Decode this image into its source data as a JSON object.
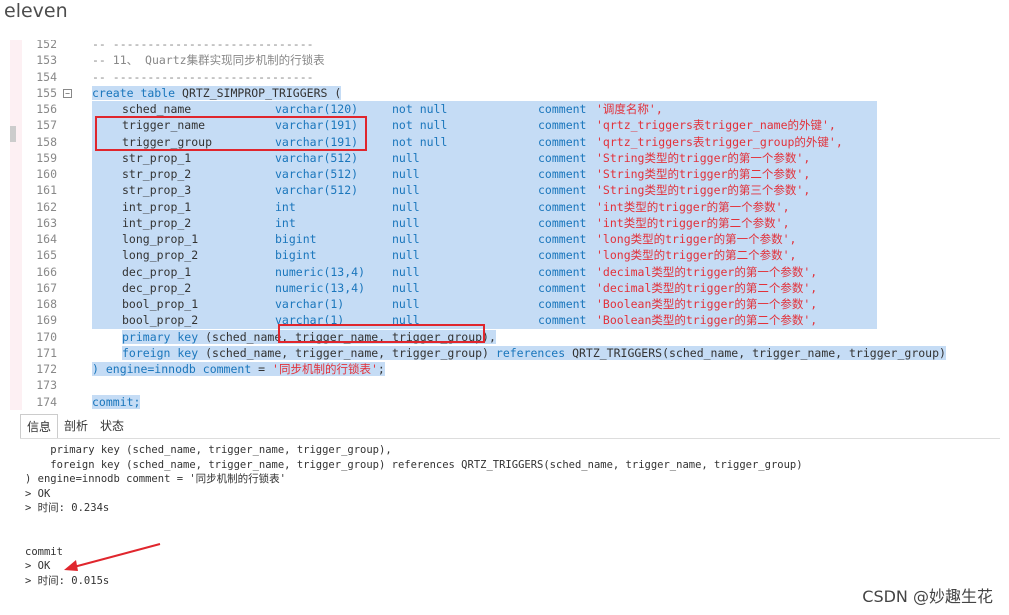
{
  "heading": "eleven",
  "editor": {
    "lines": [
      {
        "n": "152",
        "text": "-- -----------------------------"
      },
      {
        "n": "153",
        "text": "-- 11、 Quartz集群实现同步机制的行锁表"
      },
      {
        "n": "154",
        "text": "-- -----------------------------"
      },
      {
        "n": "155",
        "kw1": "create table",
        "rest": " QRTZ_SIMPROP_TRIGGERS ("
      },
      {
        "n": "156",
        "c1": "sched_name",
        "c2": "varchar(120)",
        "c3": "not null",
        "c4k": "comment",
        "c4s": "'调度名称',"
      },
      {
        "n": "157",
        "c1": "trigger_name",
        "c2": "varchar(191)",
        "c3": "not null",
        "c4k": "comment",
        "c4s": "'qrtz_triggers表trigger_name的外键',"
      },
      {
        "n": "158",
        "c1": "trigger_group",
        "c2": "varchar(191)",
        "c3": "not null",
        "c4k": "comment",
        "c4s": "'qrtz_triggers表trigger_group的外键',"
      },
      {
        "n": "159",
        "c1": "str_prop_1",
        "c2": "varchar(512)",
        "c3": "null",
        "c4k": "comment",
        "c4s": "'String类型的trigger的第一个参数',"
      },
      {
        "n": "160",
        "c1": "str_prop_2",
        "c2": "varchar(512)",
        "c3": "null",
        "c4k": "comment",
        "c4s": "'String类型的trigger的第二个参数',"
      },
      {
        "n": "161",
        "c1": "str_prop_3",
        "c2": "varchar(512)",
        "c3": "null",
        "c4k": "comment",
        "c4s": "'String类型的trigger的第三个参数',"
      },
      {
        "n": "162",
        "c1": "int_prop_1",
        "c2": "int",
        "c3": "null",
        "c4k": "comment",
        "c4s": "'int类型的trigger的第一个参数',"
      },
      {
        "n": "163",
        "c1": "int_prop_2",
        "c2": "int",
        "c3": "null",
        "c4k": "comment",
        "c4s": "'int类型的trigger的第二个参数',"
      },
      {
        "n": "164",
        "c1": "long_prop_1",
        "c2": "bigint",
        "c3": "null",
        "c4k": "comment",
        "c4s": "'long类型的trigger的第一个参数',"
      },
      {
        "n": "165",
        "c1": "long_prop_2",
        "c2": "bigint",
        "c3": "null",
        "c4k": "comment",
        "c4s": "'long类型的trigger的第二个参数',"
      },
      {
        "n": "166",
        "c1": "dec_prop_1",
        "c2": "numeric(13,4)",
        "c3": "null",
        "c4k": "comment",
        "c4s": "'decimal类型的trigger的第一个参数',"
      },
      {
        "n": "167",
        "c1": "dec_prop_2",
        "c2": "numeric(13,4)",
        "c3": "null",
        "c4k": "comment",
        "c4s": "'decimal类型的trigger的第二个参数',"
      },
      {
        "n": "168",
        "c1": "bool_prop_1",
        "c2": "varchar(1)",
        "c3": "null",
        "c4k": "comment",
        "c4s": "'Boolean类型的trigger的第一个参数',"
      },
      {
        "n": "169",
        "c1": "bool_prop_2",
        "c2": "varchar(1)",
        "c3": "null",
        "c4k": "comment",
        "c4s": "'Boolean类型的trigger的第二个参数',"
      },
      {
        "n": "170",
        "pk": "primary key",
        "pkrest": " (sched_name, trigger_name, trigger_group),"
      },
      {
        "n": "171",
        "fk": "foreign key",
        "fkrest": " (sched_name, trigger_name, trigger_group)",
        "ref": " references",
        "refrest": " QRTZ_TRIGGERS(sched_name, trigger_name, trigger_group)"
      },
      {
        "n": "172",
        "e1": ") engine=innodb ",
        "e2": "comment",
        "e3": " = ",
        "e4": "'同步机制的行锁表'",
        "e5": ";"
      },
      {
        "n": "173",
        "text": ""
      },
      {
        "n": "174",
        "commit": "commit;"
      }
    ]
  },
  "tabs": [
    "信息",
    "剖析",
    "状态"
  ],
  "output": [
    "    primary key (sched_name, trigger_name, trigger_group),",
    "    foreign key (sched_name, trigger_name, trigger_group) references QRTZ_TRIGGERS(sched_name, trigger_name, trigger_group)",
    ") engine=innodb comment = '同步机制的行锁表'",
    "> OK",
    "> 时间: 0.234s",
    "",
    "",
    "commit",
    "> OK",
    "> 时间: 0.015s"
  ],
  "watermark": "CSDN @妙趣生花"
}
